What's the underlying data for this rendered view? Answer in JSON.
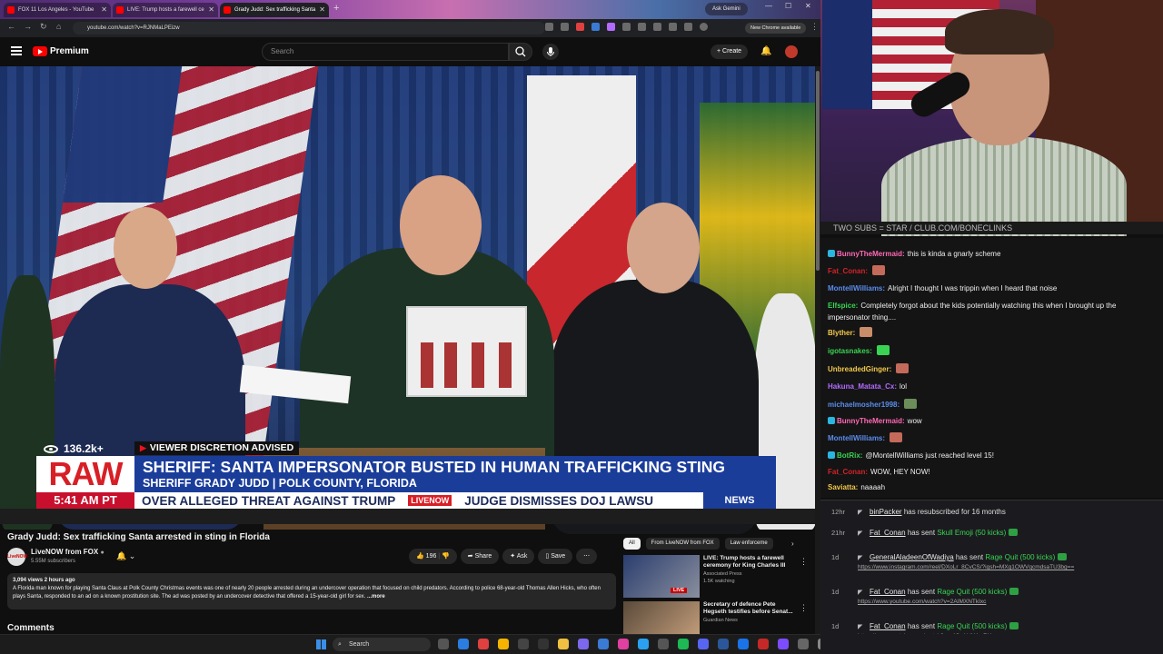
{
  "browser": {
    "tabs": [
      {
        "label": "FOX 11 Los Angeles - YouTube"
      },
      {
        "label": "LIVE: Trump hosts a farewell ce"
      },
      {
        "label": "Grady Judd: Sex trafficking Santa"
      }
    ],
    "ask_gemini": "Ask Gemini",
    "url": "youtube.com/watch?v=RJNMaLPEizw",
    "new_chrome": "New Chrome available"
  },
  "youtube": {
    "logo": "Premium",
    "search_placeholder": "Search",
    "create_label": "Create",
    "video": {
      "viewer_count": "136.2k+",
      "discretion": "VIEWER DISCRETION ADVISED",
      "raw": "RAW",
      "time": "5:41 AM PT",
      "headline": "SHERIFF: SANTA IMPERSONATOR BUSTED IN HUMAN TRAFFICKING STING",
      "subhead": "SHERIFF GRADY JUDD | POLK COUNTY, FLORIDA",
      "ticker_left": "OVER ALLEGED THREAT AGAINST TRUMP",
      "ticker_brand": "LIVENOW",
      "ticker_right": "JUDGE DISMISSES DOJ LAWSU",
      "news_tag": "NEWS"
    },
    "title": "Grady Judd: Sex trafficking Santa arrested in sting in Florida",
    "channel": {
      "name": "LiveNOW from FOX",
      "subscribers": "5.55M subscribers",
      "avatar_text": "LiveNOW"
    },
    "actions": {
      "likes": "196",
      "share": "Share",
      "ask": "Ask",
      "save": "Save"
    },
    "description": {
      "meta": "3,094 views  2 hours ago",
      "text": "A Florida man known for playing Santa Claus at Polk County Christmas events was one of nearly 20 people arrested during an undercover operation that focused on child predators. According to police 68-year-old Thomas Allen Hicks, who often plays Santa, responded to an ad on a known prostitution site. The ad was posted by an undercover detective that offered a 15-year-old girl for sex.",
      "more": "...more"
    },
    "comments_label": "Comments",
    "chips": [
      "All",
      "From LiveNOW from FOX",
      "Law enforceme"
    ],
    "recommended": [
      {
        "title": "LIVE: Trump hosts a farewell ceremony for King Charles III",
        "channel": "Associated Press",
        "meta": "1.5K watching",
        "badge": "LIVE"
      },
      {
        "title": "Secretary of defence Pete Hegseth testifies before Senat...",
        "channel": "Guardian News",
        "meta": ""
      }
    ]
  },
  "stream": {
    "banner": "TWO SUBS = STAR / CLUB.COM/BONECLINKS",
    "chat": [
      {
        "user": "BunnyTheMermaid:",
        "color": "#ff69b4",
        "text": "this is kinda a gnarly scheme"
      },
      {
        "user": "Fat_Conan:",
        "color": "#d2232a",
        "text": ""
      },
      {
        "user": "MontellWilliams:",
        "color": "#5b8def",
        "text": "Alright I thought I was trippin when I heard that noise"
      },
      {
        "user": "Elfspice:",
        "color": "#39d353",
        "text": "Completely forgot about the kids potentially watching this when I brought up the impersonator thing...."
      },
      {
        "user": "Blyther:",
        "color": "#f2c94c",
        "text": ""
      },
      {
        "user": "igotasnakes:",
        "color": "#39d353",
        "text": ""
      },
      {
        "user": "UnbreadedGinger:",
        "color": "#f2c94c",
        "text": ""
      },
      {
        "user": "Hakuna_Matata_Cx:",
        "color": "#b36bff",
        "text": "lol"
      },
      {
        "user": "michaelmosher1998:",
        "color": "#5b8def",
        "text": ""
      },
      {
        "user": "BunnyTheMermaid:",
        "color": "#ff69b4",
        "text": "wow"
      },
      {
        "user": "MontellWilliams:",
        "color": "#5b8def",
        "text": ""
      },
      {
        "user": "BotRix:",
        "color": "#39d353",
        "text": "@MontellWilliams just reached level 15!"
      },
      {
        "user": "Fat_Conan:",
        "color": "#d2232a",
        "text": "WOW, HEY NOW!"
      },
      {
        "user": "Saviatta:",
        "color": "#f2c94c",
        "text": "naaaah"
      }
    ],
    "events": [
      {
        "age": "12hr",
        "user": "binPacker",
        "text": "has resubscribed for 16 months",
        "gift": "",
        "link": ""
      },
      {
        "age": "21hr",
        "user": "Fat_Conan",
        "text": "has sent",
        "gift": "Skull Emoji (50 kicks)",
        "link": ""
      },
      {
        "age": "1d",
        "user": "GeneralAladeenOfWadiya",
        "text": "has sent",
        "gift": "Rage Quit (500 kicks)",
        "link": "https://www.instagram.com/reel/DXoLr_8CvCS/?igsh=MXg1OWVqcmdsaTU3bg=="
      },
      {
        "age": "1d",
        "user": "Fat_Conan",
        "text": "has sent",
        "gift": "Rage Quit (500 kicks)",
        "link": "https://www.youtube.com/watch?v=2AIMXNTkIxc"
      },
      {
        "age": "1d",
        "user": "Fat_Conan",
        "text": "has sent",
        "gift": "Rage Quit (500 kicks)",
        "link": "https://www.youtube.com/watch?v=-4CwVdY4mRY"
      }
    ]
  },
  "taskbar": {
    "search": "Search"
  }
}
